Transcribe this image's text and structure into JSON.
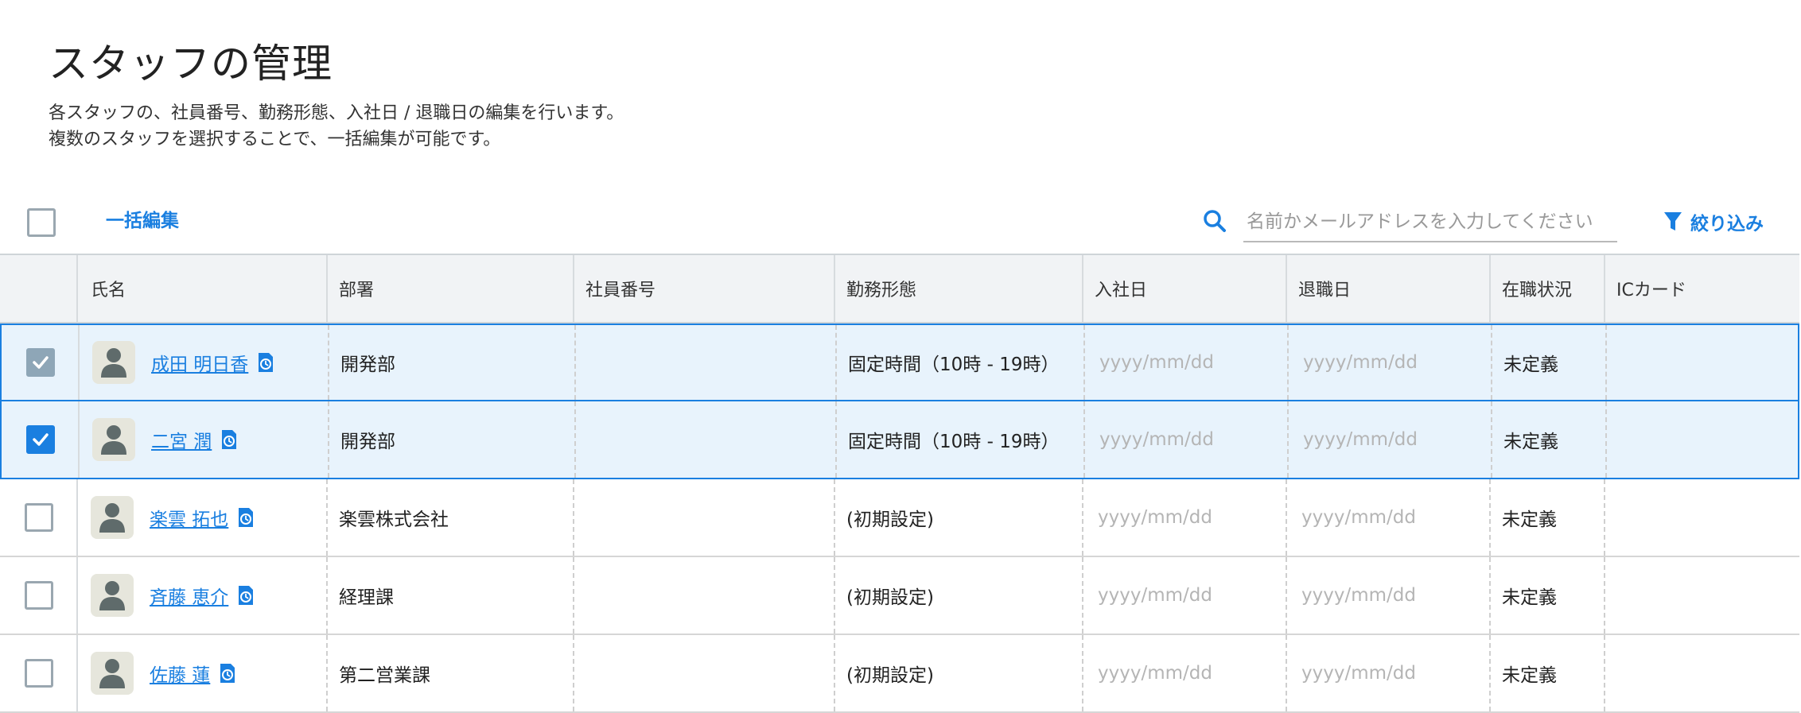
{
  "page": {
    "title": "スタッフの管理",
    "description_line1": "各スタッフの、社員番号、勤務形態、入社日 / 退職日の編集を行います。",
    "description_line2": "複数のスタッフを選択することで、一括編集が可能です。"
  },
  "toolbar": {
    "bulk_edit_label": "一括編集",
    "search_placeholder": "名前かメールアドレスを入力してください",
    "filter_label": "絞り込み"
  },
  "colors": {
    "accent": "#1a7fe0",
    "selected_row_bg": "#e8f3fc",
    "header_bg": "#f1f3f5"
  },
  "table": {
    "columns": {
      "name": "氏名",
      "department": "部署",
      "employee_number": "社員番号",
      "work_style": "勤務形態",
      "hire_date": "入社日",
      "retirement_date": "退職日",
      "employment_status": "在職状況",
      "ic_card": "ICカード"
    },
    "date_placeholder": "yyyy/mm/dd",
    "rows": [
      {
        "checked": true,
        "name": "成田 明日香",
        "department": "開発部",
        "employee_number": "",
        "work_style": "固定時間（10時 - 19時）",
        "employment_status": "未定義",
        "ic_card": ""
      },
      {
        "checked": true,
        "name": "二宮 潤",
        "department": "開発部",
        "employee_number": "",
        "work_style": "固定時間（10時 - 19時）",
        "employment_status": "未定義",
        "ic_card": ""
      },
      {
        "checked": false,
        "name": "楽雲 拓也",
        "department": "楽雲株式会社",
        "employee_number": "",
        "work_style": "(初期設定)",
        "employment_status": "未定義",
        "ic_card": ""
      },
      {
        "checked": false,
        "name": "斉藤 恵介",
        "department": "経理課",
        "employee_number": "",
        "work_style": "(初期設定)",
        "employment_status": "未定義",
        "ic_card": ""
      },
      {
        "checked": false,
        "name": "佐藤 蓮",
        "department": "第二営業課",
        "employee_number": "",
        "work_style": "(初期設定)",
        "employment_status": "未定義",
        "ic_card": ""
      }
    ]
  }
}
